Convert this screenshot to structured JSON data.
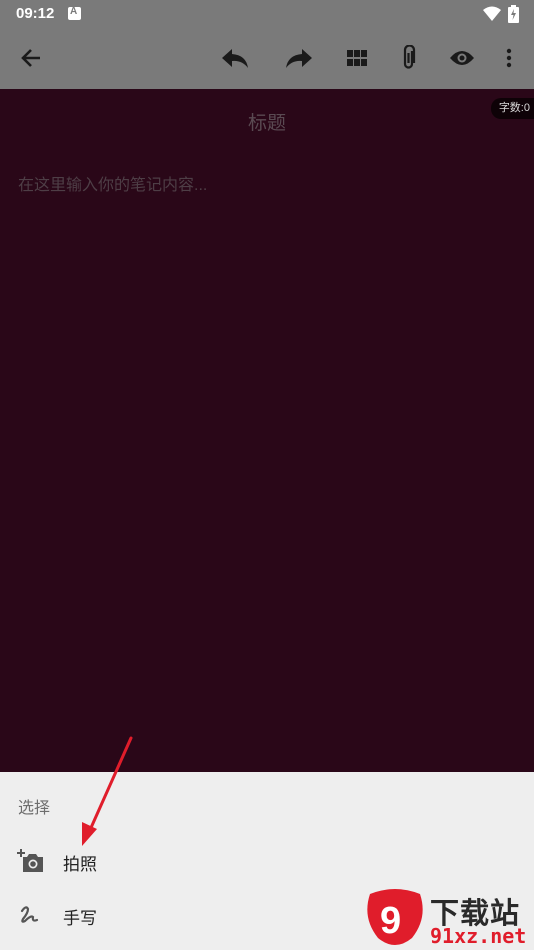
{
  "status_bar": {
    "time": "09:12",
    "notification_icon": "a-letter-icon",
    "wifi_icon": "wifi-icon",
    "battery_icon": "battery-charging-icon"
  },
  "toolbar": {
    "back_icon": "arrow-left-icon",
    "undo_icon": "undo-icon",
    "redo_icon": "redo-icon",
    "grid_icon": "grid-icon",
    "attach_icon": "paperclip-icon",
    "preview_icon": "eye-icon",
    "more_icon": "more-vert-icon",
    "background_color": "#7a7a7a"
  },
  "editor": {
    "word_count": "字数:0",
    "title_placeholder": "标题",
    "body_placeholder": "在这里输入你的笔记内容...",
    "background_color": "#2a0718"
  },
  "bottom_sheet": {
    "title": "选择",
    "items": [
      {
        "label": "拍照",
        "icon": "add-camera-icon"
      },
      {
        "label": "手写",
        "icon": "handwriting-icon"
      }
    ]
  },
  "annotation": {
    "arrow_color": "#e01d2b"
  },
  "watermark": {
    "logo_text": "9",
    "title": "下载站",
    "url": "91xz.net"
  }
}
